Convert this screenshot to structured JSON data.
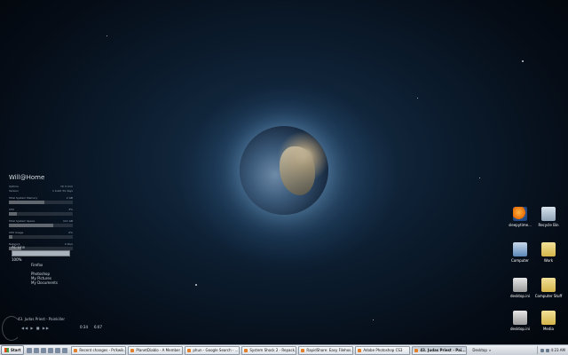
{
  "widget": {
    "title": "Will@Home",
    "rows": [
      {
        "label": "Uptime",
        "value": "hh h:mm"
      },
      {
        "label": "Version",
        "value": "1 build 34 days"
      }
    ],
    "sections": [
      {
        "label": "Total System Memory",
        "value": "2 GB",
        "bar": 0.55
      },
      {
        "label": "CPU",
        "value": "3%",
        "bar": 0.12
      },
      {
        "label": "Total System Space",
        "value": "111 GB",
        "bar": 0.7
      },
      {
        "label": "CPU Usage",
        "value": "0%",
        "bar": 0.05
      },
      {
        "label": "Network",
        "value": "0 kb/s",
        "bar": 0.2
      }
    ]
  },
  "power": {
    "label": "AC Line",
    "percent": "100%",
    "fill": 1.0
  },
  "launcher": {
    "items": [
      "Firefox",
      "Photoshop",
      "My Pictures",
      "My Documents"
    ]
  },
  "player": {
    "track": "43. Judas Priest - Painkiller",
    "controls": "◀◀ ▶ ■ ▶▶",
    "time": "0:34",
    "total": "6:07"
  },
  "desktop_icons": [
    {
      "label": "sleepytime...",
      "type": "firefox",
      "icon": "firefox-icon"
    },
    {
      "label": "Recycle Bin",
      "type": "recycle",
      "icon": "recycle-bin-icon"
    },
    {
      "label": "Computer",
      "type": "computer",
      "icon": "computer-icon"
    },
    {
      "label": "Work",
      "type": "folder",
      "icon": "folder-icon"
    },
    {
      "label": "desktop.ini",
      "type": "ini",
      "icon": "ini-file-icon"
    },
    {
      "label": "Computer Stuff",
      "type": "folder",
      "icon": "folder-icon"
    },
    {
      "label": "desktop.ini",
      "type": "ini",
      "icon": "ini-file-icon"
    },
    {
      "label": "Media",
      "type": "folder",
      "icon": "folder-icon"
    }
  ],
  "taskbar": {
    "start_label": "Start",
    "tasks": [
      {
        "label": "Recent changes - Pr/kwik...",
        "active": false
      },
      {
        "label": "PlanetDiablo - A Member ...",
        "active": false
      },
      {
        "label": "phun - Google Search - ...",
        "active": false
      },
      {
        "label": "System Shock 2 - Repack...",
        "active": false
      },
      {
        "label": "RapidShare: Easy Filehos...",
        "active": false
      },
      {
        "label": "Adobe Photoshop CS3",
        "active": false
      },
      {
        "label": "43. Judas Priest - Pai...",
        "active": true
      }
    ],
    "desktop_label": "Desktop",
    "clock": "4:23 AM"
  }
}
